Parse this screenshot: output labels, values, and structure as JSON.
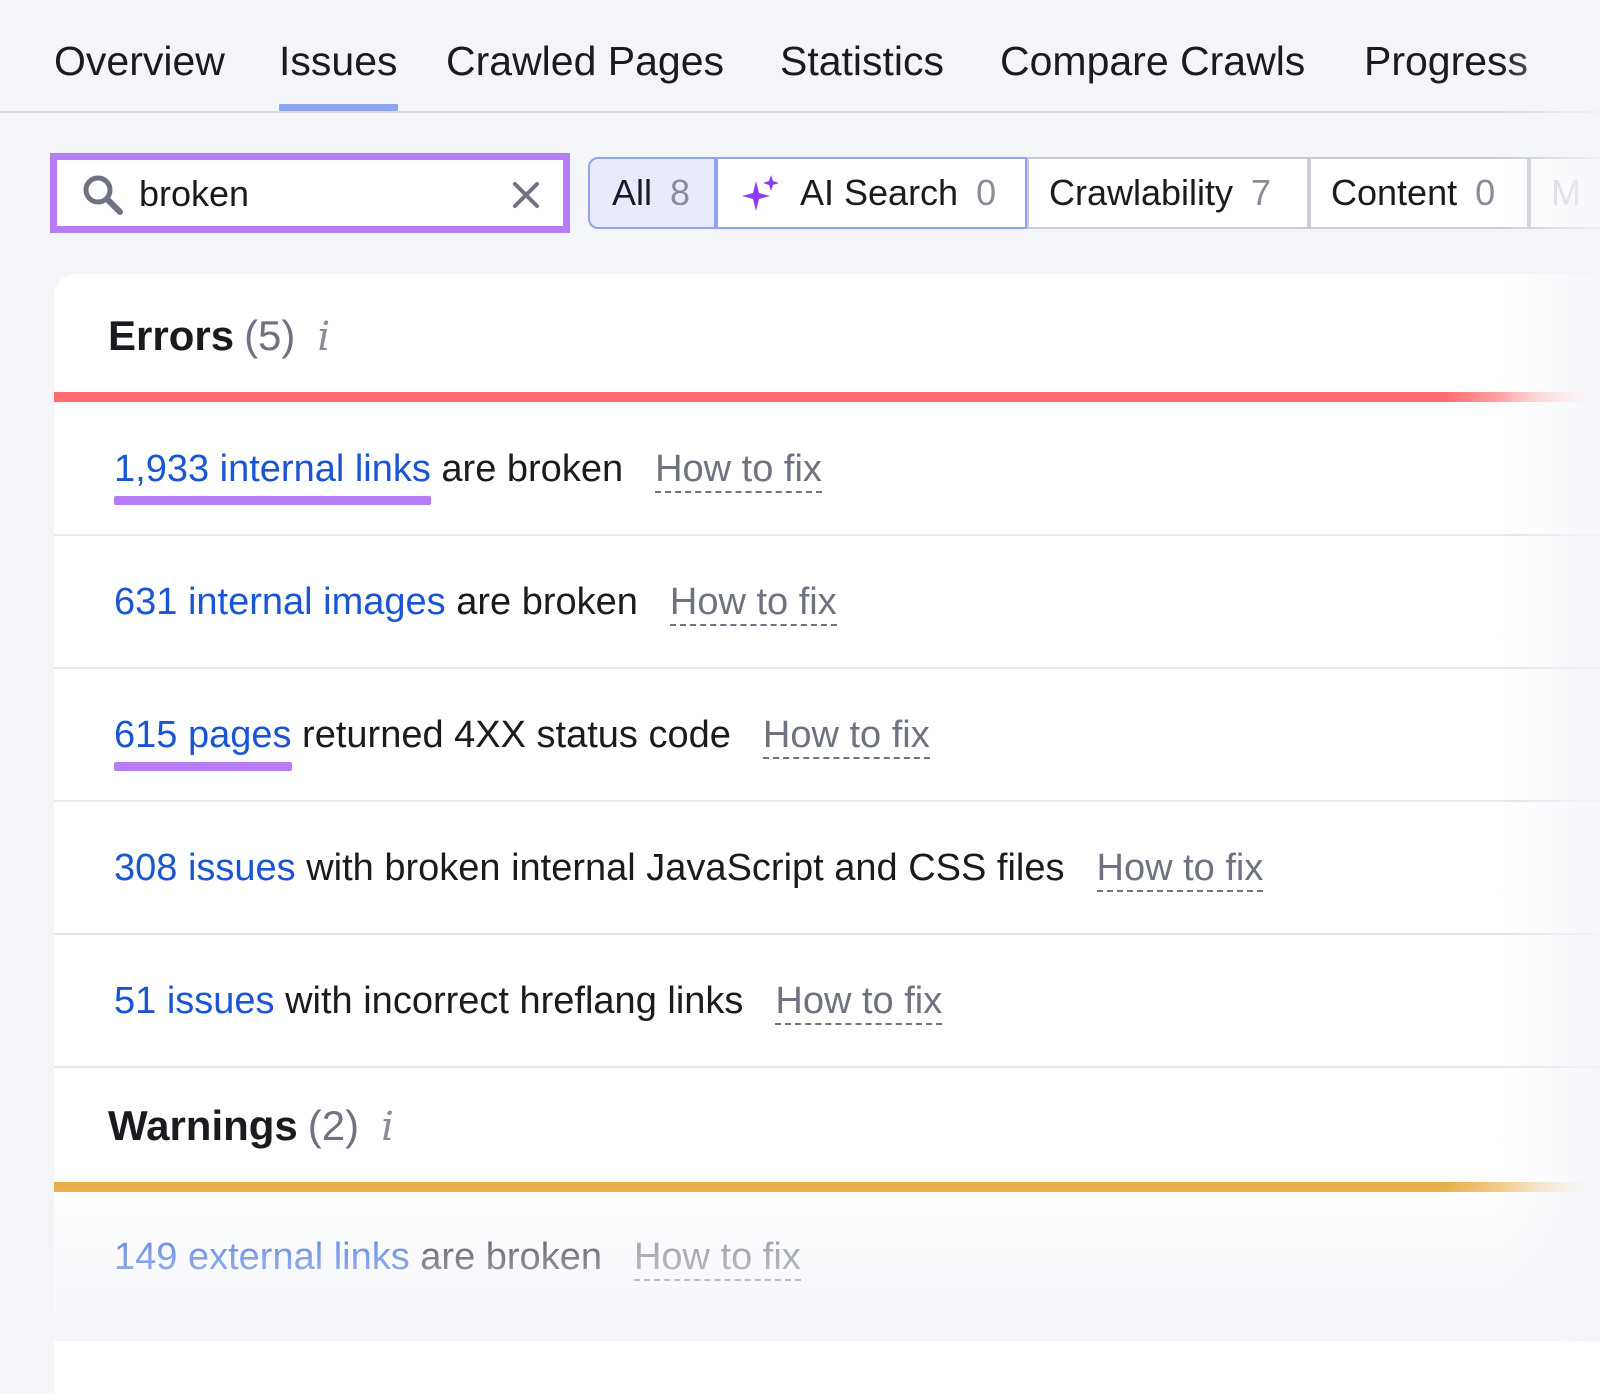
{
  "tabs": [
    {
      "label": "Overview",
      "active": false
    },
    {
      "label": "Issues",
      "active": true
    },
    {
      "label": "Crawled Pages",
      "active": false
    },
    {
      "label": "Statistics",
      "active": false
    },
    {
      "label": "Compare Crawls",
      "active": false
    },
    {
      "label": "Progress",
      "active": false
    }
  ],
  "search": {
    "value": "broken",
    "icon": "search-icon",
    "clear_icon": "close-icon"
  },
  "filters": [
    {
      "label": "All",
      "count": "8",
      "active": true
    },
    {
      "label": "AI Search",
      "count": "0",
      "icon": "sparkle-icon"
    },
    {
      "label": "Crawlability",
      "count": "7"
    },
    {
      "label": "Content",
      "count": "0"
    },
    {
      "label": "M",
      "count": ""
    }
  ],
  "errors": {
    "title": "Errors",
    "count": "(5)",
    "info": "i",
    "color": "#ff6b6f",
    "items": [
      {
        "link": "1,933 internal links",
        "text": " are broken",
        "fix": "How to fix",
        "highlight": true
      },
      {
        "link": "631 internal images",
        "text": " are broken",
        "fix": "How to fix",
        "highlight": false
      },
      {
        "link": "615 pages",
        "text": " returned 4XX status code",
        "fix": "How to fix",
        "highlight": true
      },
      {
        "link": "308 issues",
        "text": " with broken internal JavaScript and CSS files",
        "fix": "How to fix",
        "highlight": false
      },
      {
        "link": "51 issues",
        "text": " with incorrect hreflang links",
        "fix": "How to fix",
        "highlight": false
      }
    ]
  },
  "warnings": {
    "title": "Warnings",
    "count": "(2)",
    "info": "i",
    "color": "#e9a93c",
    "items": [
      {
        "link": "149 external links",
        "text": " are broken",
        "fix": "How to fix",
        "highlight": false
      }
    ]
  },
  "colors": {
    "accent_link": "#1a55d6",
    "highlight": "#b57cf5",
    "active_tab": "#8ea6f0"
  }
}
